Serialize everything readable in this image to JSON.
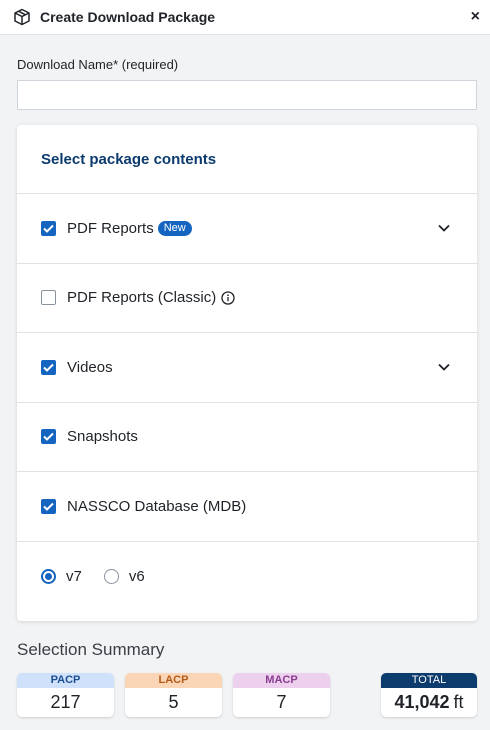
{
  "header": {
    "title": "Create Download Package",
    "icon": "package-icon",
    "close_label": "×"
  },
  "download_name": {
    "label": "Download Name* (required)",
    "value": "",
    "placeholder": ""
  },
  "contents": {
    "title": "Select package contents",
    "items": [
      {
        "label": "PDF Reports",
        "checked": true,
        "badge": "New",
        "expandable": true
      },
      {
        "label": "PDF Reports (Classic)",
        "checked": false,
        "info_icon": true
      },
      {
        "label": "Videos",
        "checked": true,
        "expandable": true
      },
      {
        "label": "Snapshots",
        "checked": true
      },
      {
        "label": "NASSCO Database (MDB)",
        "checked": true
      }
    ],
    "version_options": [
      {
        "label": "v7",
        "selected": true
      },
      {
        "label": "v6",
        "selected": false
      }
    ]
  },
  "summary": {
    "title": "Selection Summary",
    "stats": [
      {
        "label": "PACP",
        "value": "217",
        "color": "#cfe1fb"
      },
      {
        "label": "LACP",
        "value": "5",
        "color": "#fbd6b6"
      },
      {
        "label": "MACP",
        "value": "7",
        "color": "#ecd0ee"
      }
    ],
    "total": {
      "label": "TOTAL",
      "value": "41,042",
      "unit": "ft",
      "color": "#0c3b6e"
    }
  },
  "colors": {
    "accent": "#1565c0",
    "heading": "#0c3b6e"
  }
}
